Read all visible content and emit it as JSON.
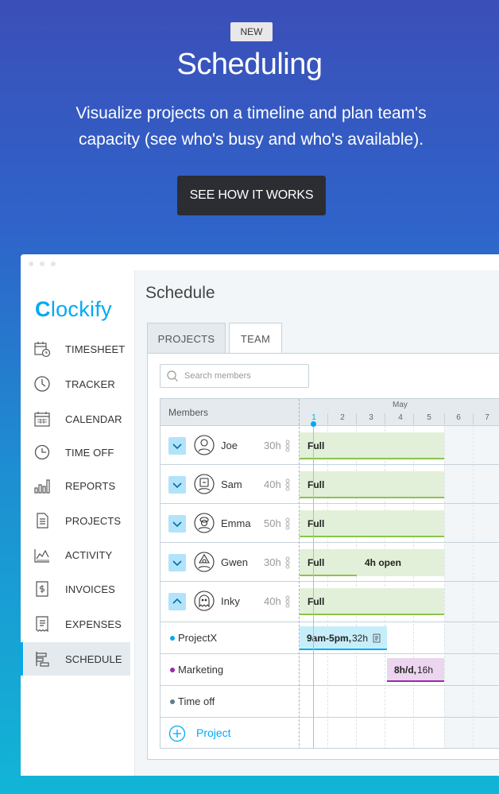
{
  "hero": {
    "badge": "NEW",
    "title": "Scheduling",
    "subtitle_line1": "Visualize projects on a timeline and plan team's",
    "subtitle_line2": "capacity (see who's busy and who's available).",
    "cta": "SEE HOW IT WORKS"
  },
  "app": {
    "logo_c": "C",
    "logo_rest": "lockify",
    "sidebar": [
      {
        "label": "TIMESHEET",
        "icon": "timesheet-icon"
      },
      {
        "label": "TRACKER",
        "icon": "clock-icon"
      },
      {
        "label": "CALENDAR",
        "icon": "calendar-icon"
      },
      {
        "label": "TIME OFF",
        "icon": "time-off-icon"
      },
      {
        "label": "REPORTS",
        "icon": "reports-icon"
      },
      {
        "label": "PROJECTS",
        "icon": "projects-icon"
      },
      {
        "label": "ACTIVITY",
        "icon": "activity-icon"
      },
      {
        "label": "INVOICES",
        "icon": "invoices-icon"
      },
      {
        "label": "EXPENSES",
        "icon": "expenses-icon"
      },
      {
        "label": "SCHEDULE",
        "icon": "schedule-icon",
        "active": true
      }
    ],
    "page_title": "Schedule",
    "tabs": {
      "projects": "PROJECTS",
      "team": "TEAM",
      "active": "TEAM"
    },
    "search_placeholder": "Search members",
    "grid": {
      "members_header": "Members",
      "month": "May",
      "days": [
        "1",
        "2",
        "3",
        "4",
        "5",
        "6",
        "7"
      ],
      "members": [
        {
          "name": "Joe",
          "hours": "30h",
          "bars": [
            {
              "label": "Full",
              "extra": ""
            }
          ]
        },
        {
          "name": "Sam",
          "hours": "40h",
          "bars": [
            {
              "label": "Full",
              "extra": ""
            }
          ]
        },
        {
          "name": "Emma",
          "hours": "50h",
          "bars": [
            {
              "label": "Full",
              "extra": ""
            }
          ]
        },
        {
          "name": "Gwen",
          "hours": "30h",
          "bars": [
            {
              "label": "Full",
              "extra": "4h open"
            }
          ]
        },
        {
          "name": "Inky",
          "hours": "40h",
          "bars": [
            {
              "label": "Full",
              "extra": ""
            }
          ]
        }
      ],
      "projects": [
        {
          "name": "ProjectX",
          "color": "#03a9f4",
          "bar_strong": "9am-5pm,",
          "bar_rest": " 32h"
        },
        {
          "name": "Marketing",
          "color": "#9c27b0",
          "bar_strong": "8h/d,",
          "bar_rest": " 16h"
        },
        {
          "name": "Time off",
          "color": "#607d8b",
          "bar_strong": "",
          "bar_rest": ""
        }
      ],
      "add_project": "Project"
    }
  },
  "colors": {
    "accent": "#03a9f4",
    "full_bar": "#e2f0d9",
    "full_bar_border": "#8bc34a",
    "projectx_bar": "#c6eefa",
    "marketing_bar": "#ecd5ee"
  }
}
